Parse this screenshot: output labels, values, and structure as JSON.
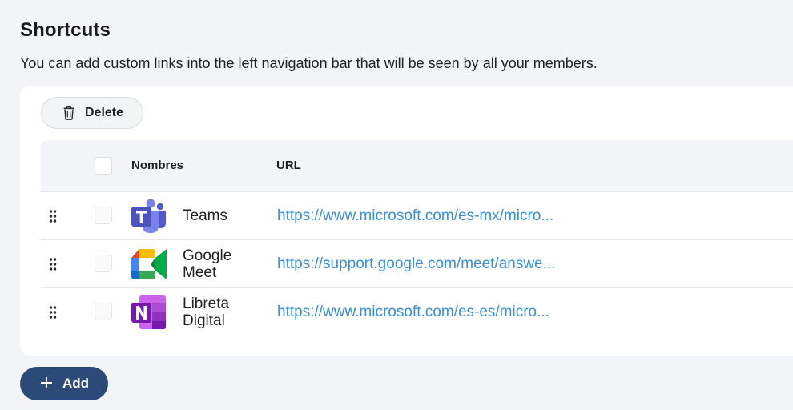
{
  "header": {
    "title": "Shortcuts",
    "description": "You can add custom links into the left navigation bar that will be seen by all your members."
  },
  "toolbar": {
    "delete_label": "Delete",
    "delete_icon": "trash-icon"
  },
  "table": {
    "columns": {
      "name": "Nombres",
      "url": "URL"
    },
    "rows": [
      {
        "icon": "teams-icon",
        "name": "Teams",
        "url": "https://www.microsoft.com/es-mx/micro..."
      },
      {
        "icon": "google-meet-icon",
        "name": "Google Meet",
        "url": "https://support.google.com/meet/answe..."
      },
      {
        "icon": "onenote-icon",
        "name": "Libreta Digital",
        "url": "https://www.microsoft.com/es-es/micro..."
      }
    ]
  },
  "footer": {
    "add_label": "Add",
    "add_icon": "plus-icon"
  },
  "colors": {
    "accent": "#2b4a78",
    "link": "#3a8fd6",
    "background": "#f3f4f7"
  }
}
